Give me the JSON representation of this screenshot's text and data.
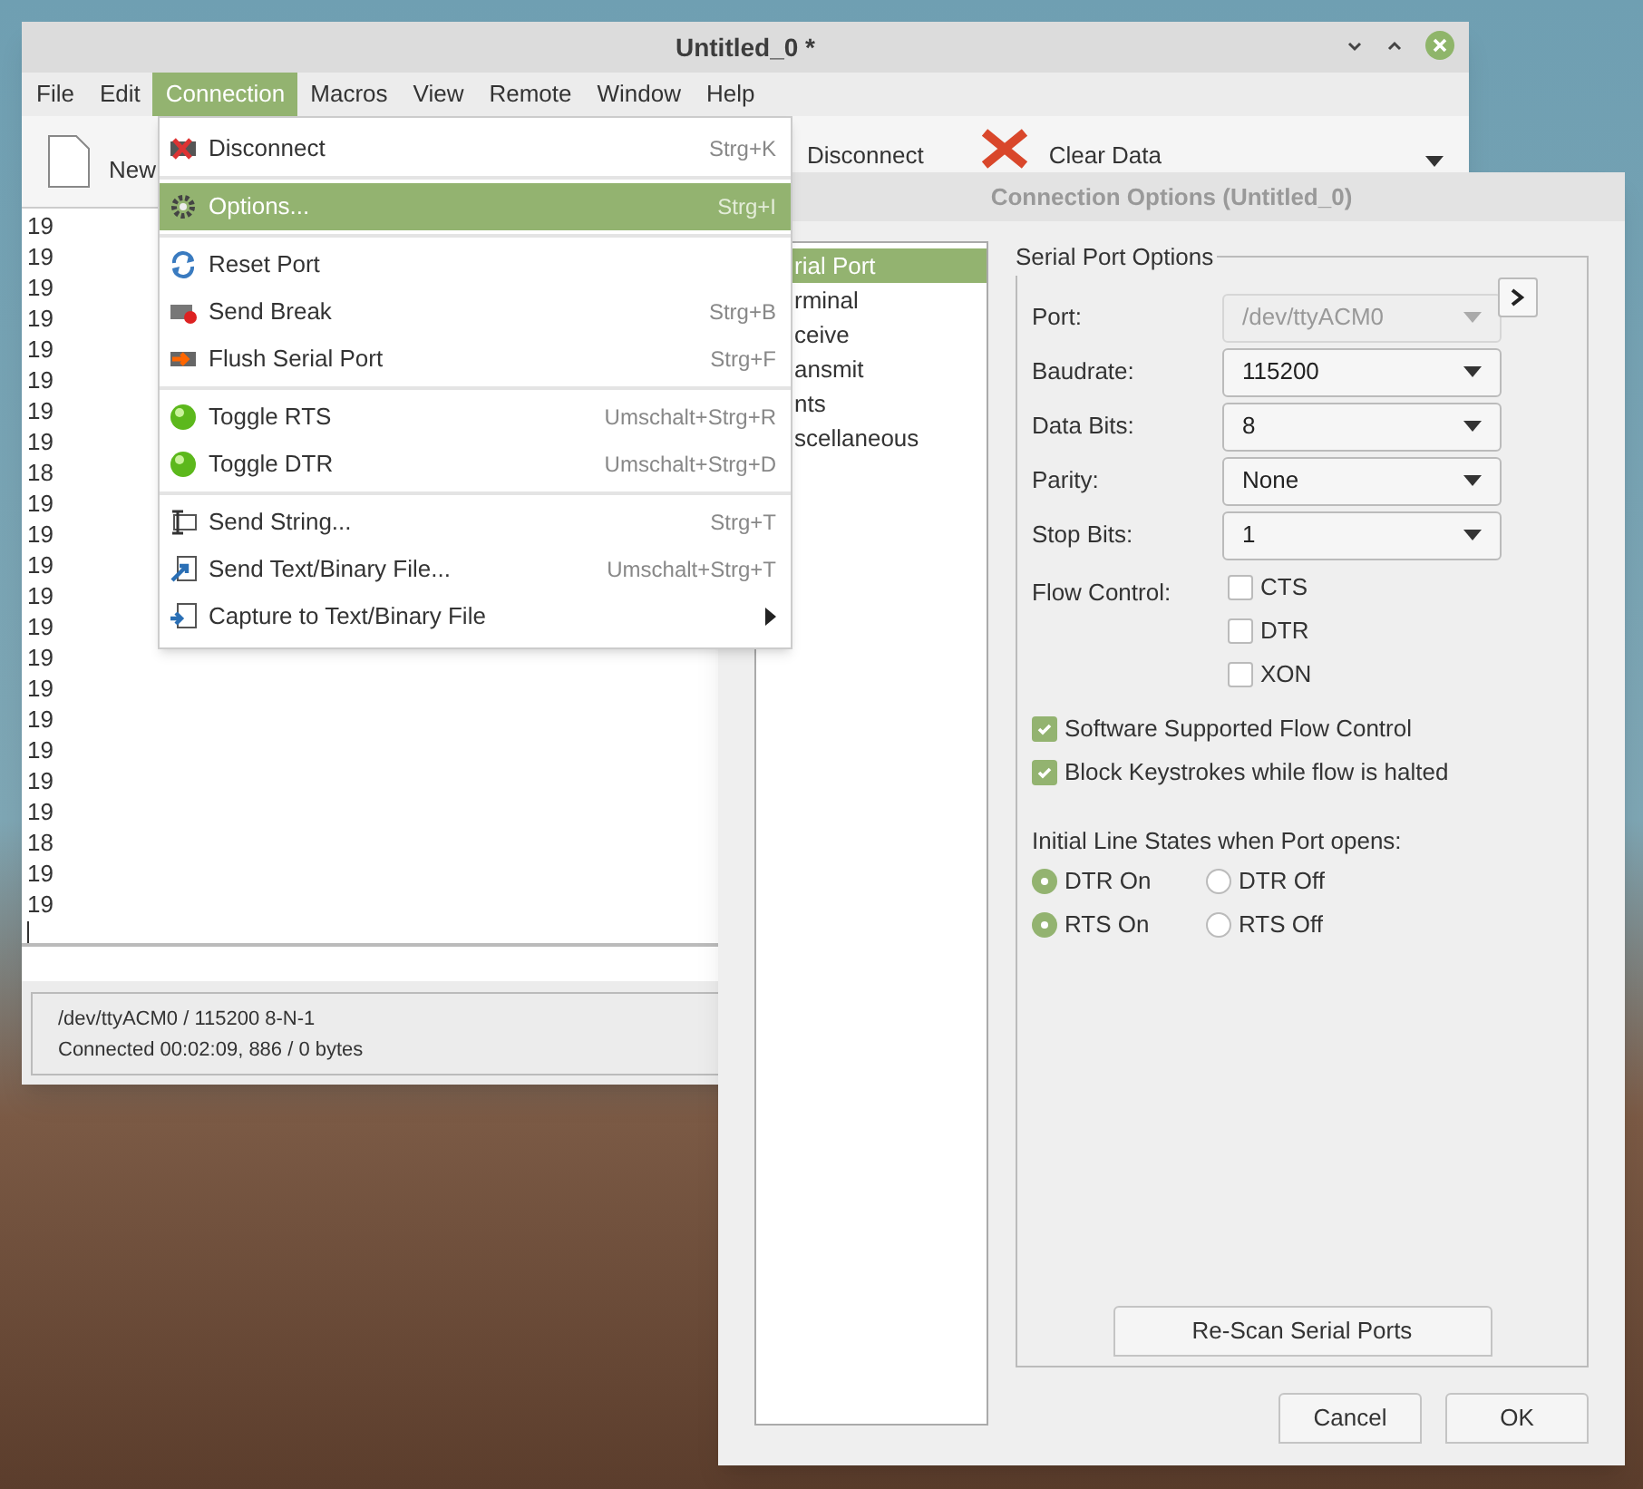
{
  "main_window": {
    "title": "Untitled_0 *",
    "menu_bar": [
      {
        "label": "File",
        "selected": false
      },
      {
        "label": "Edit",
        "selected": false
      },
      {
        "label": "Connection",
        "selected": true
      },
      {
        "label": "Macros",
        "selected": false
      },
      {
        "label": "View",
        "selected": false
      },
      {
        "label": "Remote",
        "selected": false
      },
      {
        "label": "Window",
        "selected": false
      },
      {
        "label": "Help",
        "selected": false
      }
    ],
    "toolbar": [
      {
        "label": "New"
      },
      {
        "label": "Disconnect"
      },
      {
        "label": "Clear Data"
      }
    ],
    "terminal_lines": [
      "19",
      "19",
      "19",
      "19",
      "19",
      "19",
      "19",
      "19",
      "18",
      "19",
      "19",
      "19",
      "19",
      "19",
      "19",
      "19",
      "19",
      "19",
      "19",
      "19",
      "18",
      "19",
      "19"
    ],
    "status_bar": [
      "/dev/ttyACM0 / 115200 8-N-1",
      "Connected 00:02:09, 886 / 0 bytes"
    ]
  },
  "connection_menu": {
    "groups": [
      [
        {
          "label": "Disconnect",
          "shortcut": "Strg+K",
          "selected": false,
          "submenu": false
        }
      ],
      [
        {
          "label": "Options...",
          "shortcut": "Strg+I",
          "selected": true,
          "submenu": false
        }
      ],
      [
        {
          "label": "Reset Port",
          "selected": false,
          "submenu": false
        },
        {
          "label": "Send Break",
          "shortcut": "Strg+B",
          "selected": false,
          "submenu": false
        },
        {
          "label": "Flush Serial Port",
          "shortcut": "Strg+F",
          "selected": false,
          "submenu": false
        }
      ],
      [
        {
          "label": "Toggle RTS",
          "shortcut": "Umschalt+Strg+R",
          "selected": false,
          "submenu": false
        },
        {
          "label": "Toggle DTR",
          "shortcut": "Umschalt+Strg+D",
          "selected": false,
          "submenu": false
        }
      ],
      [
        {
          "label": "Send String...",
          "shortcut": "Strg+T",
          "selected": false,
          "submenu": false
        },
        {
          "label": "Send Text/Binary File...",
          "shortcut": "Umschalt+Strg+T",
          "selected": false,
          "submenu": false
        },
        {
          "label": "Capture to Text/Binary File",
          "selected": false,
          "submenu": true
        }
      ]
    ]
  },
  "dialog": {
    "title": "Connection Options (Untitled_0)",
    "tree": [
      {
        "label": "rial Port",
        "selected": true
      },
      {
        "label": "rminal",
        "selected": false
      },
      {
        "label": "ceive",
        "selected": false
      },
      {
        "label": "ansmit",
        "selected": false
      },
      {
        "label": "nts",
        "selected": false
      },
      {
        "label": "scellaneous",
        "selected": false
      }
    ],
    "group_title": "Serial Port Options",
    "fields": [
      {
        "label": "Port:",
        "value": "/dev/ttyACM0",
        "disabled": true
      },
      {
        "label": "Baudrate:",
        "value": "115200",
        "disabled": false
      },
      {
        "label": "Data Bits:",
        "value": "8",
        "disabled": false
      },
      {
        "label": "Parity:",
        "value": "None",
        "disabled": false
      },
      {
        "label": "Stop Bits:",
        "value": "1",
        "disabled": false
      }
    ],
    "flow_control_label": "Flow Control:",
    "flow_control": [
      {
        "label": "CTS",
        "checked": false
      },
      {
        "label": "DTR",
        "checked": false
      },
      {
        "label": "XON",
        "checked": false
      }
    ],
    "options": [
      {
        "label": "Software Supported Flow Control",
        "checked": true
      },
      {
        "label": "Block Keystrokes while flow is halted",
        "checked": true
      }
    ],
    "line_states_label": "Initial Line States when Port opens:",
    "line_states": [
      [
        {
          "label": "DTR On",
          "selected": true
        },
        {
          "label": "DTR Off",
          "selected": false
        }
      ],
      [
        {
          "label": "RTS On",
          "selected": true
        },
        {
          "label": "RTS Off",
          "selected": false
        }
      ]
    ],
    "rescan_button": "Re-Scan Serial Ports",
    "buttons": [
      "Cancel",
      "OK"
    ]
  }
}
